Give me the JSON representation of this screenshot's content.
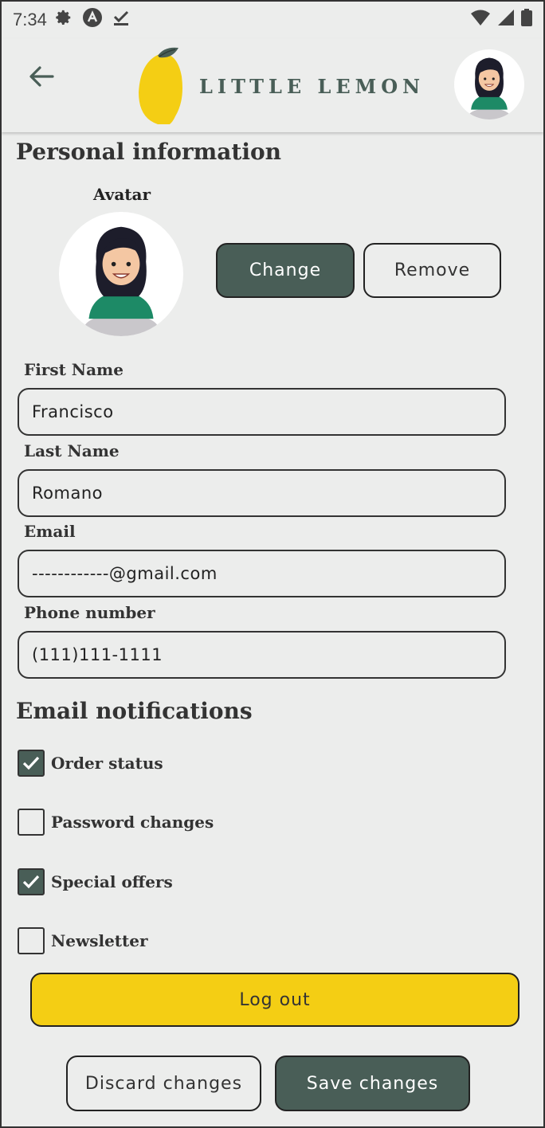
{
  "status_bar": {
    "time": "7:34",
    "icons": [
      "gear-icon",
      "app-icon",
      "download-done-icon"
    ],
    "right_icons": [
      "wifi-icon",
      "signal-icon",
      "battery-icon"
    ]
  },
  "header": {
    "brand": "LITTLE LEMON",
    "back_icon": "arrow-left-icon"
  },
  "personal": {
    "title": "Personal information",
    "avatar_label": "Avatar",
    "change_label": "Change",
    "remove_label": "Remove"
  },
  "fields": {
    "first_name_label": "First Name",
    "first_name_value": "Francisco",
    "last_name_label": "Last Name",
    "last_name_value": "Romano",
    "email_label": "Email",
    "email_value": "------------@gmail.com",
    "phone_label": "Phone number",
    "phone_value": "(111)111-1111"
  },
  "notifications": {
    "title": "Email notifications",
    "items": [
      {
        "label": "Order status",
        "checked": true
      },
      {
        "label": "Password changes",
        "checked": false
      },
      {
        "label": "Special offers",
        "checked": true
      },
      {
        "label": "Newsletter",
        "checked": false
      }
    ]
  },
  "actions": {
    "logout_label": "Log out",
    "discard_label": "Discard changes",
    "save_label": "Save changes"
  },
  "colors": {
    "primary_green": "#495e57",
    "primary_yellow": "#f4ce14",
    "background": "#ecedec"
  }
}
